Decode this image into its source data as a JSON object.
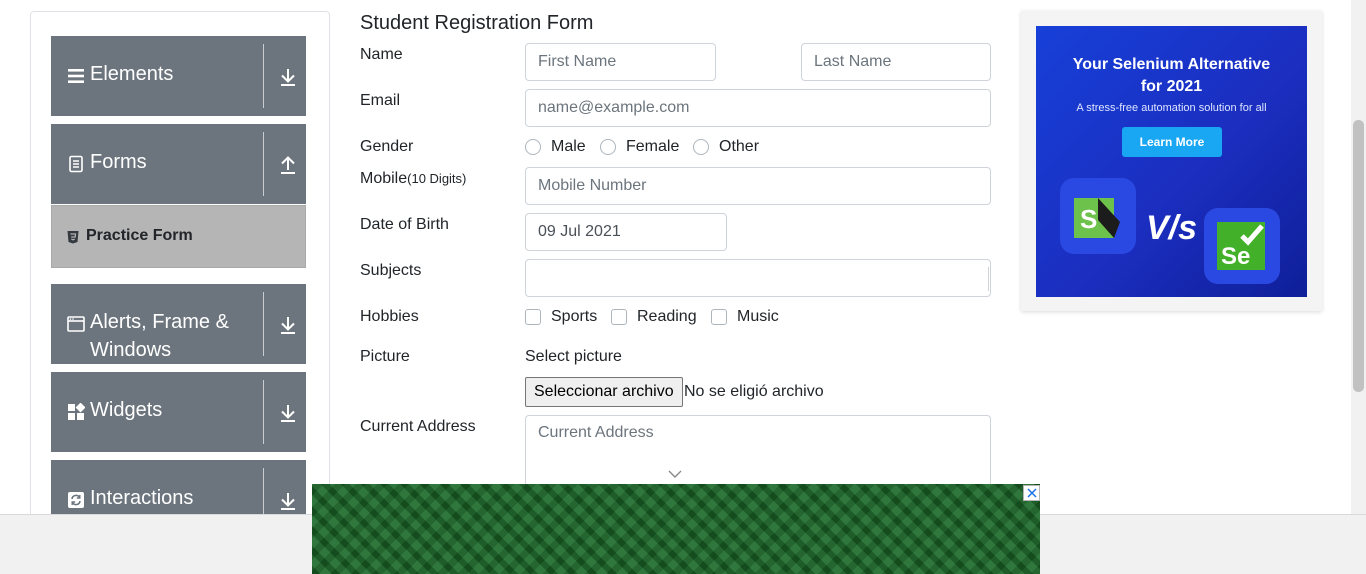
{
  "sidebar": {
    "groups": [
      {
        "label": "Elements",
        "icon": "hamburger-icon",
        "arrow": "download-arrow-icon"
      },
      {
        "label": "Forms",
        "icon": "document-icon",
        "arrow": "upload-arrow-icon"
      },
      {
        "label": "Alerts, Frame & Windows",
        "icon": "window-icon",
        "arrow": "download-arrow-icon"
      },
      {
        "label": "Widgets",
        "icon": "widgets-icon",
        "arrow": "download-arrow-icon"
      },
      {
        "label": "Interactions",
        "icon": "refresh-icon",
        "arrow": "download-arrow-icon"
      }
    ],
    "active_item": "Practice Form"
  },
  "form": {
    "title": "Student Registration Form",
    "name_label": "Name",
    "first_name_placeholder": "First Name",
    "last_name_placeholder": "Last Name",
    "email_label": "Email",
    "email_placeholder": "name@example.com",
    "gender_label": "Gender",
    "gender_options": [
      "Male",
      "Female",
      "Other"
    ],
    "mobile_label": "Mobile",
    "mobile_hint": "(10 Digits)",
    "mobile_placeholder": "Mobile Number",
    "dob_label": "Date of Birth",
    "dob_value": "09 Jul 2021",
    "subjects_label": "Subjects",
    "hobbies_label": "Hobbies",
    "hobby_options": [
      "Sports",
      "Reading",
      "Music"
    ],
    "picture_label": "Picture",
    "select_picture": "Select picture",
    "file_button": "Seleccionar archivo",
    "file_status": "No se eligió archivo",
    "address_label": "Current Address",
    "address_placeholder": "Current Address"
  },
  "ad": {
    "headline_line1": "Your Selenium Alternative",
    "headline_line2": "for 2021",
    "subtext": "A stress-free automation solution for all",
    "button": "Learn More",
    "vs": "V/s",
    "colors": {
      "background": "#1b2ec0",
      "button": "#19a6f2",
      "katalon": "#6cc24a",
      "selenium": "#43b02a"
    }
  },
  "colors": {
    "sidebar_group": "#6c757d",
    "active_item": "#b5b5b5",
    "banner_green": "#1b6a2a"
  }
}
